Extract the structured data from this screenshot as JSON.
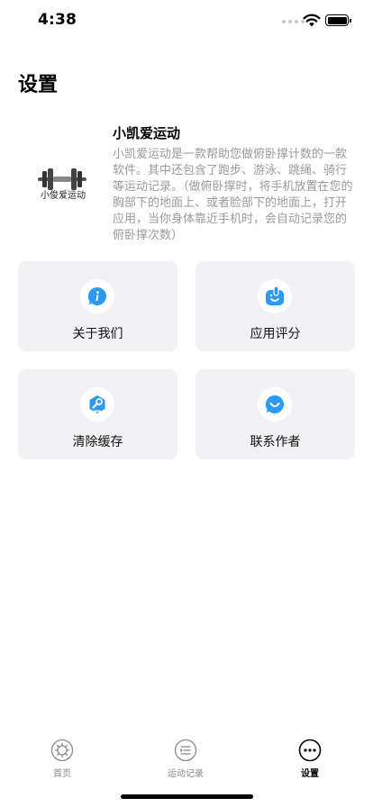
{
  "status_bar": {
    "time": "4:38"
  },
  "page_title": "设置",
  "app_info": {
    "logo_label": "小俊爱运动",
    "name": "小凯爱运动",
    "description": "小凯爱运动是一款帮助您做俯卧撑计数的一款软件。其中还包含了跑步、游泳、跳绳、骑行等运动记录。（做俯卧撑时，将手机放置在您的胸部下的地面上、或者脸部下的地面上，打开应用，当你身体靠近手机时，会自动记录您的俯卧撑次数）"
  },
  "cards": {
    "about": {
      "label": "关于我们",
      "icon": "info-icon"
    },
    "rate": {
      "label": "应用评分",
      "icon": "thumbs-up-icon"
    },
    "clear": {
      "label": "清除缓存",
      "icon": "wrench-icon"
    },
    "contact": {
      "label": "联系作者",
      "icon": "chat-smile-icon"
    }
  },
  "tabs": {
    "home": {
      "label": "首页",
      "icon": "home-icon"
    },
    "records": {
      "label": "运动记录",
      "icon": "list-icon"
    },
    "settings": {
      "label": "设置",
      "icon": "more-icon",
      "active": true
    }
  },
  "colors": {
    "accent": "#2b9af3",
    "card_bg": "#f2f2f5",
    "muted_text": "#9a9a9a"
  }
}
